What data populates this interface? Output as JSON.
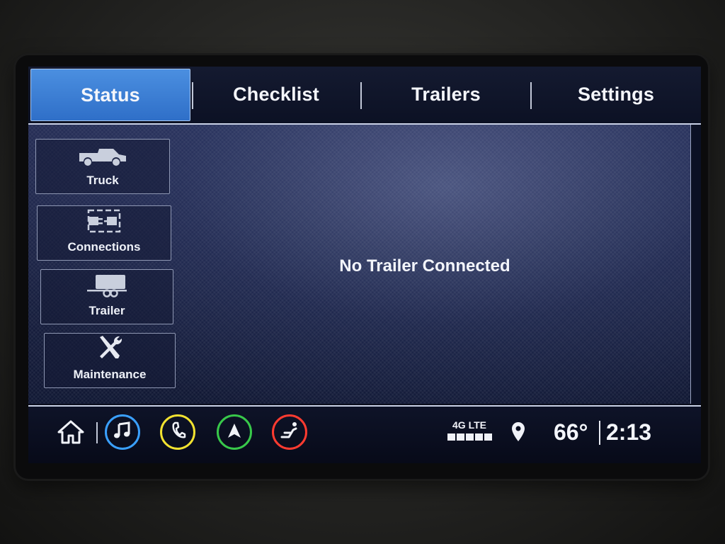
{
  "tabs": [
    {
      "label": "Status",
      "active": true
    },
    {
      "label": "Checklist",
      "active": false
    },
    {
      "label": "Trailers",
      "active": false
    },
    {
      "label": "Settings",
      "active": false
    }
  ],
  "sidebar": {
    "items": [
      {
        "label": "Truck",
        "icon": "truck-icon"
      },
      {
        "label": "Connections",
        "icon": "plug-connection-icon"
      },
      {
        "label": "Trailer",
        "icon": "trailer-icon"
      },
      {
        "label": "Maintenance",
        "icon": "wrench-screwdriver-icon"
      }
    ]
  },
  "main": {
    "message": "No Trailer Connected"
  },
  "bottombar": {
    "home_icon": "home-icon",
    "apps": [
      {
        "name": "audio",
        "icon": "music-note-icon",
        "color": "#3aa0ff"
      },
      {
        "name": "phone",
        "icon": "phone-icon",
        "color": "#f2e230"
      },
      {
        "name": "navigation",
        "icon": "navigation-arrow-icon",
        "color": "#38c84a"
      },
      {
        "name": "climate",
        "icon": "seat-icon",
        "color": "#ff3b30"
      }
    ],
    "network": "4G LTE",
    "signal_bars": 5,
    "location_icon": "location-pin-icon",
    "temperature": "66°",
    "time": "2:13"
  },
  "colors": {
    "accent": "#3f83d8",
    "text": "#f3f5fb",
    "background": "#101733"
  }
}
